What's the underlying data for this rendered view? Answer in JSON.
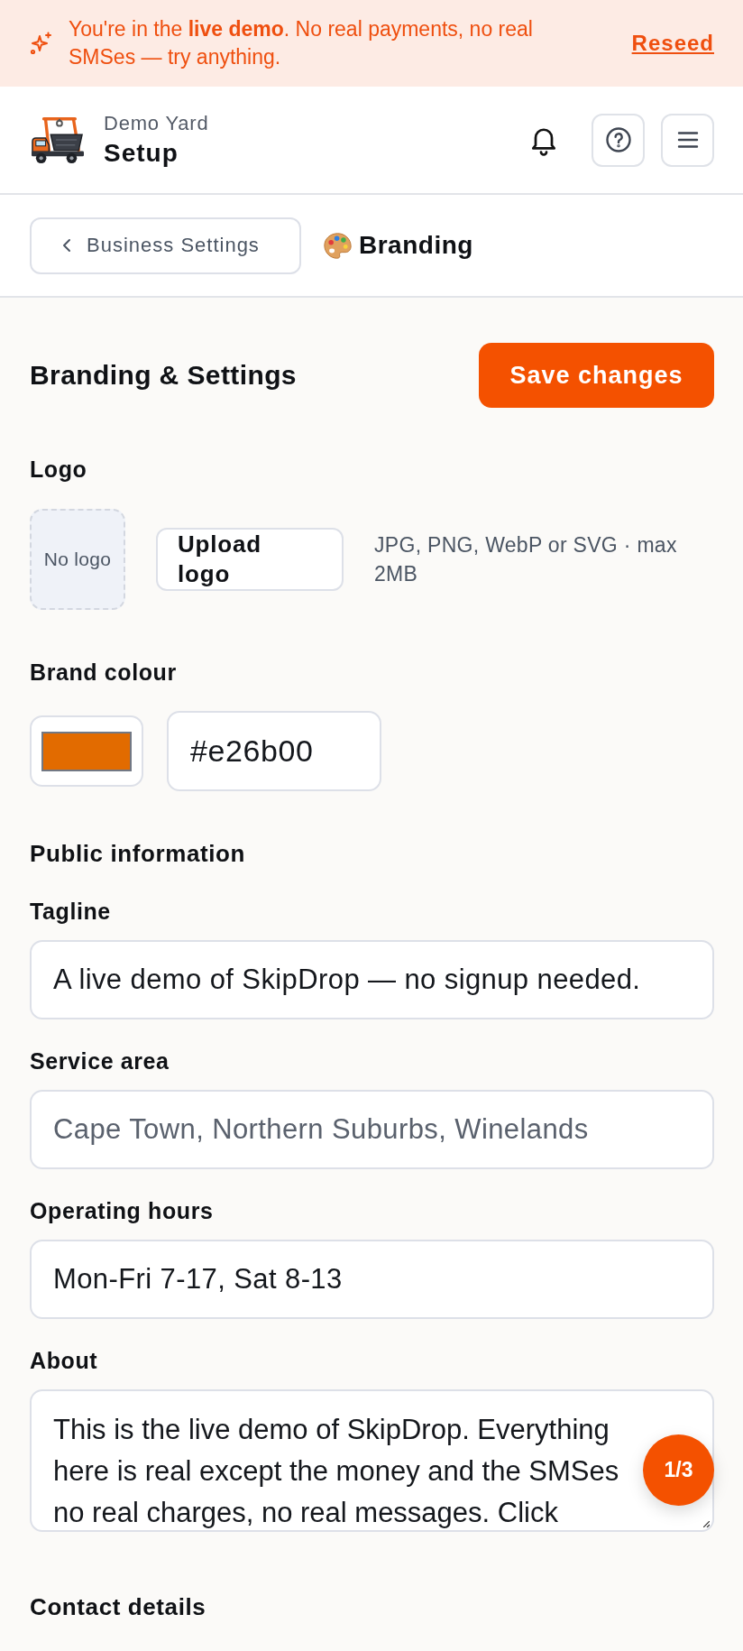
{
  "demo_banner": {
    "message": "You're in the **live demo**. No real payments, no real SMSes — try anything.",
    "link": "Reseed"
  },
  "header": {
    "workspace": "Demo Yard",
    "title": "Setup"
  },
  "breadcrumb": {
    "back": "Business Settings",
    "current": "Branding"
  },
  "page": {
    "title": "Branding & Settings",
    "save_button": "Save changes"
  },
  "logo": {
    "label": "Logo",
    "preview": "No logo",
    "upload_button": "Upload logo",
    "hint": "JPG, PNG, WebP or SVG · max 2MB"
  },
  "brand_colour": {
    "label": "Brand colour",
    "value": "#e26b00"
  },
  "public_information": {
    "heading": "Public information",
    "fields": [
      {
        "kind": "text",
        "label": "Tagline",
        "value": "A live demo of SkipDrop — no signup needed."
      },
      {
        "kind": "text",
        "label": "Service area",
        "placeholder": "Cape Town, Northern Suburbs, Winelands"
      },
      {
        "kind": "text",
        "label": "Operating hours",
        "value": "Mon-Fri 7-17, Sat 8-13"
      },
      {
        "kind": "textarea",
        "label": "About",
        "value": "This is the live demo of SkipDrop. Everything here is real except the money and the SMSes no real charges, no real messages. Click"
      }
    ]
  },
  "contact_details": {
    "heading": "Contact details"
  },
  "tour_badge": "1/3"
}
